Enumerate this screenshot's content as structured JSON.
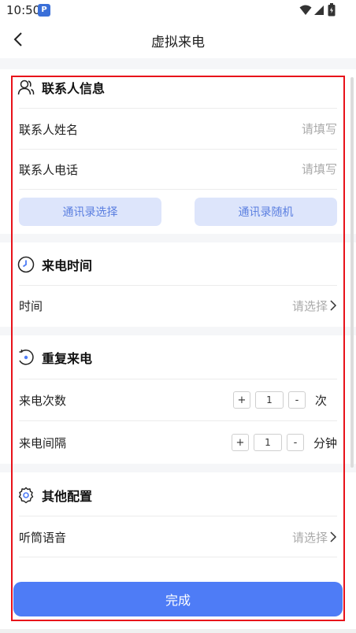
{
  "status_bar": {
    "time": "10:50",
    "app_badge": "P"
  },
  "header": {
    "title": "虚拟来电"
  },
  "contact": {
    "section_title": "联系人信息",
    "name_label": "联系人姓名",
    "name_placeholder": "请填写",
    "phone_label": "联系人电话",
    "phone_placeholder": "请填写",
    "btn_contacts_select": "通讯录选择",
    "btn_contacts_random": "通讯录随机"
  },
  "call_time": {
    "section_title": "来电时间",
    "time_label": "时间",
    "time_value": "请选择"
  },
  "repeat": {
    "section_title": "重复来电",
    "count_label": "来电次数",
    "count_value": "1",
    "count_unit": "次",
    "interval_label": "来电间隔",
    "interval_value": "1",
    "interval_unit": "分钟",
    "plus": "+",
    "minus": "-"
  },
  "other": {
    "section_title": "其他配置",
    "audio_label": "听筒语音",
    "audio_value": "请选择"
  },
  "footer": {
    "done_label": "完成"
  },
  "colors": {
    "accent": "#4e7cf6",
    "pill_bg": "#dde5fb",
    "highlight": "#e8121a"
  }
}
